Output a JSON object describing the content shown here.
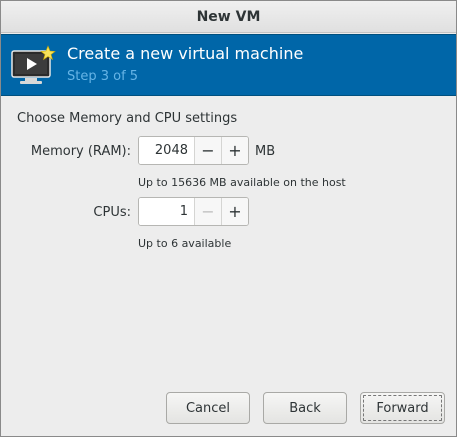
{
  "window": {
    "title": "New VM"
  },
  "banner": {
    "icon": "vm-monitor-star-icon",
    "header": "Create a new virtual machine",
    "step": "Step 3 of 5",
    "background": "#0066a8",
    "step_color": "#66b4e6"
  },
  "form": {
    "section_title": "Choose Memory and CPU settings",
    "memory": {
      "label": "Memory (RAM):",
      "value": "2048",
      "unit": "MB",
      "hint": "Up to 15636 MB available on the host",
      "decrement_icon": "minus-icon",
      "increment_icon": "plus-icon"
    },
    "cpus": {
      "label": "CPUs:",
      "value": "1",
      "hint": "Up to 6 available",
      "decrement_icon": "minus-icon",
      "increment_icon": "plus-icon"
    }
  },
  "buttons": {
    "cancel": "Cancel",
    "back": "Back",
    "forward": "Forward"
  }
}
